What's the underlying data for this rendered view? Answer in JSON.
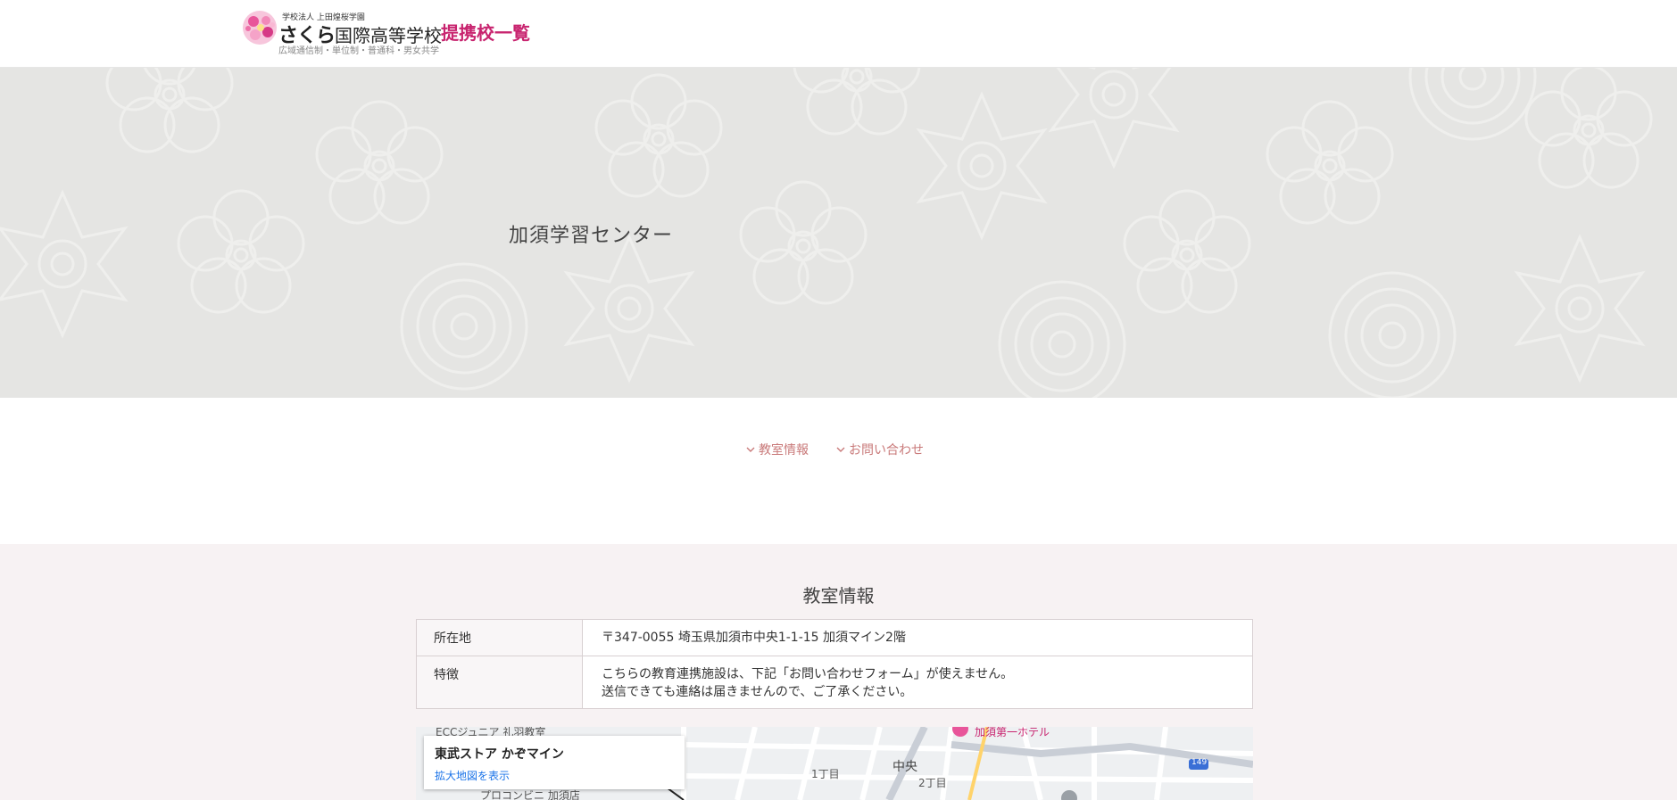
{
  "header": {
    "logo_small_top": "学校法人 上田煌桜学園",
    "logo_name_kana": "さくら",
    "logo_name_main": "国際高等学校",
    "logo_small_bottom": "広域通信制・単位制・普通科・男女共学",
    "link_label": "提携校一覧"
  },
  "hero": {
    "title": "加須学習センター"
  },
  "anchors": [
    {
      "label": "教室情報"
    },
    {
      "label": "お問い合わせ"
    }
  ],
  "info": {
    "title": "教室情報",
    "rows": [
      {
        "header": "所在地",
        "value": "〒347-0055 埼玉県加須市中央1-1-15 加須マイン2階",
        "value2": ""
      },
      {
        "header": "特徴",
        "value": "こちらの教育連携施設は、下記「お問い合わせフォーム」が使えません。",
        "value2": "送信できても連絡は届きませんので、ご了承ください。"
      }
    ]
  },
  "map": {
    "place_name": "東武ストア かぞマイン",
    "enlarge_link": "拡大地図を表示",
    "labels": {
      "school": "ECCジュニア 礼羽教室",
      "hotel": "加須第一ホテル",
      "chome1": "1丁目",
      "chuo": "中央",
      "chome2": "2丁目",
      "store": "プロコンビニ 加須店",
      "route": "149"
    }
  },
  "colors": {
    "brand": "#c8246f",
    "anchor": "#c97a7a",
    "hero_bg": "#e5e5e3",
    "section_bg": "#f7f2f3"
  }
}
